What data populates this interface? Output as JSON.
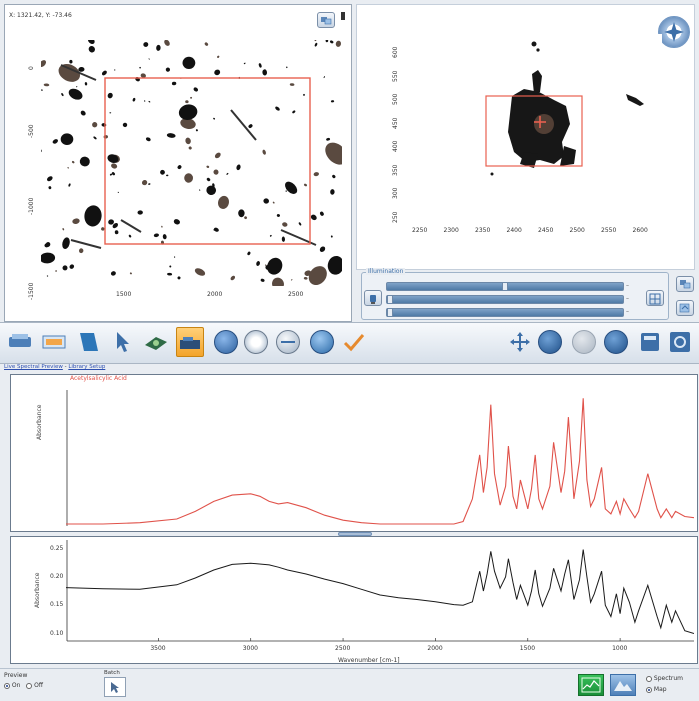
{
  "top_left": {
    "coord_readout": "X: 1321.42, Y: -73.46",
    "x_ticks": [
      "1500",
      "2000",
      "2500"
    ],
    "y_ticks": [
      "0",
      "-500",
      "-1000",
      "-1500"
    ]
  },
  "top_right": {
    "x_ticks": [
      "2250",
      "2300",
      "2350",
      "2400",
      "2450",
      "2500",
      "2550",
      "2600"
    ],
    "y_ticks": [
      "600",
      "550",
      "500",
      "450",
      "400",
      "350",
      "300",
      "250"
    ]
  },
  "illumination": {
    "label": "Illumination",
    "sliders": [
      {
        "level": 0.5
      },
      {
        "level": 0.0
      },
      {
        "level": 0.0
      }
    ]
  },
  "spectrum_header": {
    "link_left": "Live Spectral Preview",
    "separator": " - ",
    "link_right": "Library Setup",
    "legend_name": "Acetylsalicylic Acid"
  },
  "spectrum_top": {
    "ylabel": "Absorbance"
  },
  "spectrum_bottom": {
    "ylabel": "Absorbance",
    "xlabel": "Wavenumber [cm-1]",
    "y_ticks": [
      "0.25",
      "0.20",
      "0.15",
      "0.10"
    ],
    "x_ticks": [
      "3500",
      "3000",
      "2500",
      "2000",
      "1500",
      "1000"
    ]
  },
  "bottom_bar": {
    "preview_label": "Preview",
    "on_label": "On",
    "off_label": "Off",
    "batch_label": "Batch",
    "spectrum_label": "Spectrum",
    "map_label": "Map"
  },
  "colors": {
    "reference_spectrum": "#e0524a",
    "sample_spectrum": "#1a1a1a",
    "selection_box": "#e8604f",
    "accent_blue": "#3d6fa8",
    "active_tool": "#f3a42b"
  },
  "chart_data": [
    {
      "type": "line",
      "series": [
        {
          "name": "Acetylsalicylic Acid",
          "x": [
            4000,
            3800,
            3600,
            3400,
            3300,
            3200,
            3100,
            3000,
            2950,
            2900,
            2850,
            2800,
            2700,
            2600,
            2500,
            2400,
            2300,
            2200,
            2000,
            1900,
            1850,
            1800,
            1760,
            1740,
            1720,
            1700,
            1680,
            1650,
            1620,
            1605,
            1580,
            1560,
            1540,
            1500,
            1480,
            1460,
            1440,
            1420,
            1380,
            1360,
            1320,
            1300,
            1280,
            1250,
            1220,
            1200,
            1180,
            1160,
            1140,
            1100,
            1080,
            1050,
            1020,
            1000,
            980,
            950,
            920,
            900,
            850,
            800,
            780,
            750,
            720,
            700,
            650,
            600
          ],
          "y": [
            0.0,
            0.0,
            0.01,
            0.04,
            0.1,
            0.18,
            0.23,
            0.24,
            0.22,
            0.18,
            0.16,
            0.17,
            0.13,
            0.07,
            0.03,
            0.01,
            0.0,
            0.0,
            0.0,
            0.0,
            0.02,
            0.2,
            0.55,
            0.25,
            0.45,
            0.95,
            0.4,
            0.15,
            0.3,
            0.62,
            0.22,
            0.12,
            0.35,
            0.12,
            0.28,
            0.55,
            0.2,
            0.12,
            0.3,
            0.65,
            0.25,
            0.42,
            0.85,
            0.2,
            0.5,
            1.0,
            0.35,
            0.14,
            0.2,
            0.45,
            0.12,
            0.08,
            0.18,
            0.08,
            0.2,
            0.12,
            0.05,
            0.1,
            0.4,
            0.12,
            0.05,
            0.12,
            0.05,
            0.1,
            0.06,
            0.05
          ]
        }
      ],
      "xlim": [
        4000,
        600
      ],
      "ylabel": "Absorbance"
    },
    {
      "type": "line",
      "series": [
        {
          "x": [
            4000,
            3800,
            3600,
            3400,
            3300,
            3200,
            3100,
            3000,
            2900,
            2850,
            2800,
            2700,
            2600,
            2500,
            2400,
            2300,
            2200,
            2100,
            2000,
            1900,
            1850,
            1800,
            1760,
            1740,
            1720,
            1700,
            1680,
            1650,
            1620,
            1605,
            1580,
            1560,
            1540,
            1500,
            1480,
            1460,
            1440,
            1420,
            1380,
            1360,
            1320,
            1300,
            1280,
            1250,
            1220,
            1200,
            1180,
            1160,
            1140,
            1100,
            1080,
            1050,
            1020,
            1000,
            980,
            950,
            920,
            900,
            850,
            800,
            780,
            750,
            720,
            700,
            650,
            600
          ],
          "y": [
            0.181,
            0.179,
            0.178,
            0.186,
            0.198,
            0.212,
            0.222,
            0.224,
            0.221,
            0.217,
            0.212,
            0.205,
            0.196,
            0.188,
            0.178,
            0.168,
            0.163,
            0.16,
            0.156,
            0.151,
            0.15,
            0.156,
            0.21,
            0.175,
            0.205,
            0.245,
            0.21,
            0.18,
            0.2,
            0.232,
            0.19,
            0.16,
            0.185,
            0.15,
            0.175,
            0.212,
            0.17,
            0.148,
            0.18,
            0.215,
            0.175,
            0.205,
            0.23,
            0.16,
            0.195,
            0.248,
            0.2,
            0.155,
            0.17,
            0.21,
            0.15,
            0.13,
            0.17,
            0.135,
            0.18,
            0.155,
            0.12,
            0.14,
            0.185,
            0.13,
            0.11,
            0.15,
            0.12,
            0.14,
            0.105,
            0.1
          ]
        }
      ],
      "xlim": [
        4000,
        600
      ],
      "ylim": [
        0.085,
        0.265
      ],
      "y_ticks": [
        0.25,
        0.2,
        0.15,
        0.1
      ],
      "x_ticks": [
        3500,
        3000,
        2500,
        2000,
        1500,
        1000
      ],
      "xlabel": "Wavenumber [cm-1]",
      "ylabel": "Absorbance"
    }
  ]
}
